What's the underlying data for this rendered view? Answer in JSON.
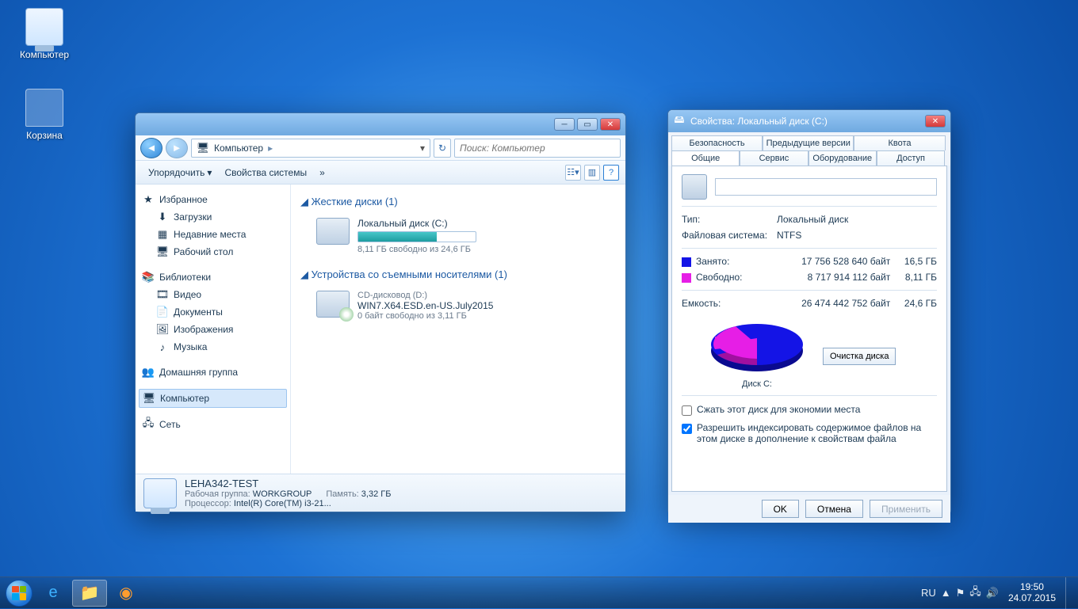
{
  "desktop": {
    "icons": [
      "Компьютер",
      "Корзина"
    ]
  },
  "explorer": {
    "path_icon": "computer-icon",
    "path": [
      "Компьютер"
    ],
    "search_placeholder": "Поиск: Компьютер",
    "toolbar": {
      "organize": "Упорядочить",
      "sys_props": "Свойства системы",
      "more": "»"
    },
    "tree": {
      "favorites": "Избранное",
      "fav_items": [
        "Загрузки",
        "Недавние места",
        "Рабочий стол"
      ],
      "libraries": "Библиотеки",
      "lib_items": [
        "Видео",
        "Документы",
        "Изображения",
        "Музыка"
      ],
      "homegroup": "Домашняя группа",
      "computer": "Компьютер",
      "network": "Сеть"
    },
    "sections": {
      "hdd": "Жесткие диски (1)",
      "removable": "Устройства со съемными носителями (1)"
    },
    "drives": {
      "c": {
        "name": "Локальный диск (C:)",
        "sub": "8,11 ГБ свободно из 24,6 ГБ",
        "fill_pct": 67
      },
      "d": {
        "name": "CD-дисковод (D:)",
        "label": "WIN7.X64.ESD.en-US.July2015",
        "sub": "0 байт свободно из 3,11 ГБ"
      }
    },
    "status": {
      "name": "LEHA342-TEST",
      "wg_k": "Рабочая группа:",
      "wg_v": "WORKGROUP",
      "mem_k": "Память:",
      "mem_v": "3,32 ГБ",
      "cpu_k": "Процессор:",
      "cpu_v": "Intel(R) Core(TM) i3-21..."
    }
  },
  "props": {
    "title": "Свойства: Локальный диск (C:)",
    "tabs_row1": [
      "Безопасность",
      "Предыдущие версии",
      "Квота"
    ],
    "tabs_row2": [
      "Общие",
      "Сервис",
      "Оборудование",
      "Доступ"
    ],
    "active_tab": "Общие",
    "type_k": "Тип:",
    "type_v": "Локальный диск",
    "fs_k": "Файловая система:",
    "fs_v": "NTFS",
    "used_k": "Занято:",
    "used_bytes": "17 756 528 640 байт",
    "used_gb": "16,5 ГБ",
    "free_k": "Свободно:",
    "free_bytes": "8 717 914 112 байт",
    "free_gb": "8,11 ГБ",
    "cap_k": "Емкость:",
    "cap_bytes": "26 474 442 752 байт",
    "cap_gb": "24,6 ГБ",
    "pie_label": "Диск C:",
    "cleanup": "Очистка диска",
    "compress": "Сжать этот диск для экономии места",
    "index": "Разрешить индексировать содержимое файлов на этом диске в дополнение к свойствам файла",
    "btn_ok": "OK",
    "btn_cancel": "Отмена",
    "btn_apply": "Применить",
    "colors": {
      "used": "#1414e6",
      "free": "#e61ee6"
    }
  },
  "taskbar": {
    "lang": "RU",
    "time": "19:50",
    "date": "24.07.2015"
  },
  "chart_data": {
    "type": "pie",
    "title": "Диск C:",
    "series": [
      {
        "name": "Занято",
        "value": 17756528640,
        "display": "16,5 ГБ",
        "color": "#1414e6"
      },
      {
        "name": "Свободно",
        "value": 8717914112,
        "display": "8,11 ГБ",
        "color": "#e61ee6"
      }
    ],
    "total": {
      "value": 26474442752,
      "display": "24,6 ГБ"
    }
  }
}
